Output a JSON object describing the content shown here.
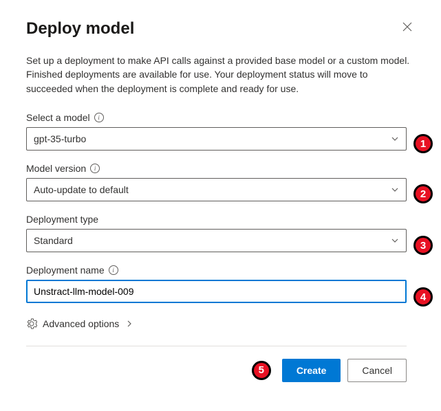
{
  "header": {
    "title": "Deploy model"
  },
  "description": "Set up a deployment to make API calls against a provided base model or a custom model. Finished deployments are available for use. Your deployment status will move to succeeded when the deployment is complete and ready for use.",
  "fields": {
    "model": {
      "label": "Select a model",
      "value": "gpt-35-turbo"
    },
    "version": {
      "label": "Model version",
      "value": "Auto-update to default"
    },
    "type": {
      "label": "Deployment type",
      "value": "Standard"
    },
    "name": {
      "label": "Deployment name",
      "value": "Unstract-llm-model-009"
    }
  },
  "advanced": {
    "label": "Advanced options"
  },
  "footer": {
    "create": "Create",
    "cancel": "Cancel"
  },
  "markers": {
    "m1": "1",
    "m2": "2",
    "m3": "3",
    "m4": "4",
    "m5": "5"
  }
}
